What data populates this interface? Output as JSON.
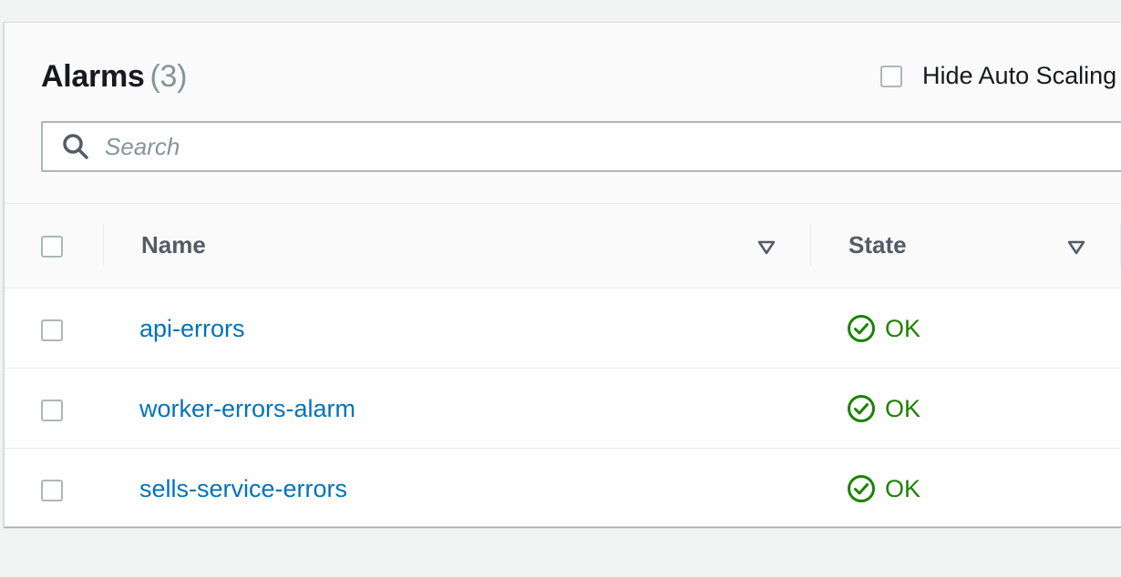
{
  "alarms_panel": {
    "title": "Alarms",
    "count": "(3)",
    "hide_auto_scaling_label": "Hide Auto Scaling alarms",
    "search": {
      "placeholder": "Search",
      "value": ""
    }
  },
  "table": {
    "columns": [
      {
        "label": "Name"
      },
      {
        "label": "State"
      }
    ],
    "rows": [
      {
        "name": "api-errors",
        "state": "OK",
        "state_icon": "check-circle-icon"
      },
      {
        "name": "worker-errors-alarm",
        "state": "OK",
        "state_icon": "check-circle-icon"
      },
      {
        "name": "sells-service-errors",
        "state": "OK",
        "state_icon": "check-circle-icon"
      }
    ]
  },
  "colors": {
    "link": "#0073bb",
    "ok": "#1d8102",
    "header_bg": "#fafafa",
    "page_bg": "#f2f3f3"
  }
}
